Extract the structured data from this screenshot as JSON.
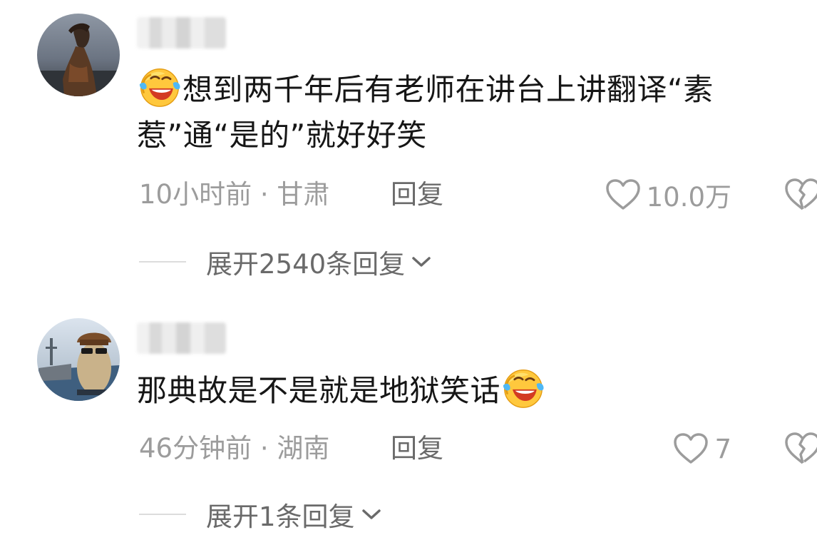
{
  "comments": [
    {
      "text_before": "想到两千年后有老师在讲台上讲翻译“素惹”通“是的”就好好笑",
      "text_after": "",
      "time": "10小时前",
      "location": "甘肃",
      "reply_label": "回复",
      "likes": "10.0万",
      "expand_label": "展开2540条回复",
      "emoji_position": "start"
    },
    {
      "text_before": "那典故是不是就是地狱笑话",
      "text_after": "",
      "time": "46分钟前",
      "location": "湖南",
      "reply_label": "回复",
      "likes": "7",
      "expand_label": "展开1条回复",
      "emoji_position": "end"
    }
  ],
  "meta_separator": " · ",
  "icons": {
    "emoji": "laughing-crying-emoji-icon",
    "like": "heart-outline-icon",
    "dislike": "broken-heart-icon",
    "expand": "chevron-down-icon"
  },
  "colors": {
    "text": "#161616",
    "meta": "#9c9c9c",
    "action": "#6a6a6a",
    "divider": "#dcdcdc",
    "background": "#ffffff"
  }
}
